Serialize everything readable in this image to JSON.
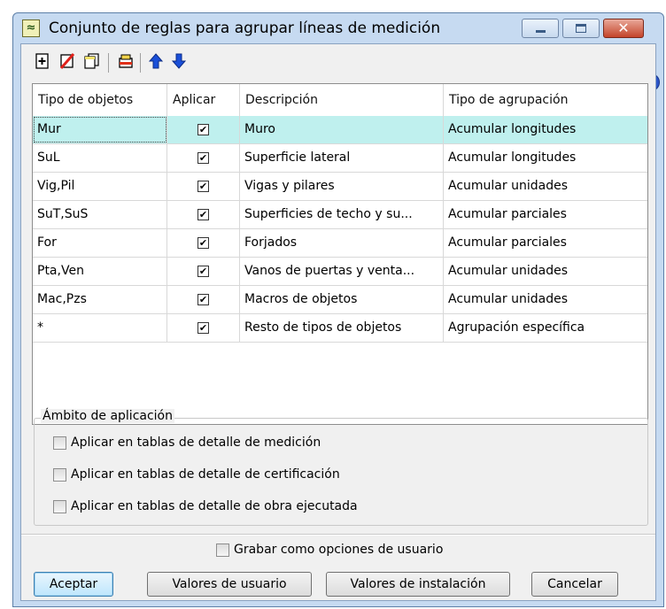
{
  "window": {
    "title": "Conjunto de reglas para agrupar líneas de medición",
    "minimize_glyph": "",
    "maximize_glyph": "",
    "close_glyph": "✕"
  },
  "toolbar": {
    "icons": [
      "add-row-icon",
      "delete-row-icon",
      "copy-icon",
      "export-icon",
      "move-up-icon",
      "move-down-icon"
    ]
  },
  "help_glyph": "?",
  "table": {
    "headers": [
      "Tipo de objetos",
      "Aplicar",
      "Descripción",
      "Tipo de agrupación"
    ],
    "rows": [
      {
        "tipo": "Mur",
        "aplicar": "✔",
        "descripcion": "Muro",
        "agrupacion": "Acumular longitudes"
      },
      {
        "tipo": "SuL",
        "aplicar": "✔",
        "descripcion": "Superficie lateral",
        "agrupacion": "Acumular longitudes"
      },
      {
        "tipo": "Vig,Pil",
        "aplicar": "✔",
        "descripcion": "Vigas y pilares",
        "agrupacion": "Acumular unidades"
      },
      {
        "tipo": "SuT,SuS",
        "aplicar": "✔",
        "descripcion": "Superficies de techo y su...",
        "agrupacion": "Acumular parciales"
      },
      {
        "tipo": "For",
        "aplicar": "✔",
        "descripcion": "Forjados",
        "agrupacion": "Acumular parciales"
      },
      {
        "tipo": "Pta,Ven",
        "aplicar": "✔",
        "descripcion": "Vanos de puertas y venta...",
        "agrupacion": "Acumular unidades"
      },
      {
        "tipo": "Mac,Pzs",
        "aplicar": "✔",
        "descripcion": "Macros de objetos",
        "agrupacion": "Acumular unidades"
      },
      {
        "tipo": "*",
        "aplicar": "✔",
        "descripcion": "Resto de tipos de objetos",
        "agrupacion": "Agrupación específica"
      }
    ]
  },
  "ambito": {
    "legend": "Ámbito de aplicación",
    "options": [
      "Aplicar en tablas de detalle de medición",
      "Aplicar en tablas de detalle de certificación",
      "Aplicar en tablas de detalle de obra ejecutada"
    ]
  },
  "save_option": "Grabar como opciones de usuario",
  "buttons": {
    "accept": "Aceptar",
    "user_values": "Valores de usuario",
    "install_values": "Valores de instalación",
    "cancel": "Cancelar"
  }
}
